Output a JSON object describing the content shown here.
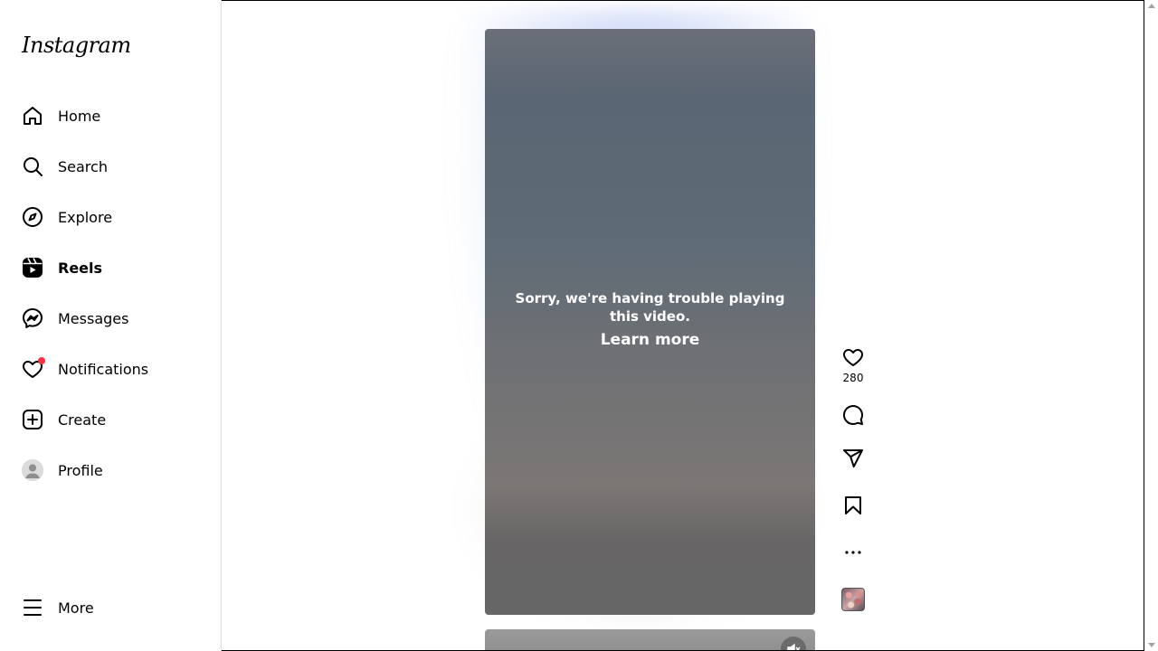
{
  "app": {
    "logo": "Instagram"
  },
  "sidebar": {
    "items": [
      {
        "label": "Home",
        "icon": "home-icon"
      },
      {
        "label": "Search",
        "icon": "search-icon"
      },
      {
        "label": "Explore",
        "icon": "compass-icon"
      },
      {
        "label": "Reels",
        "icon": "reels-icon",
        "active": true
      },
      {
        "label": "Messages",
        "icon": "messenger-icon"
      },
      {
        "label": "Notifications",
        "icon": "heart-icon",
        "badge": "dot"
      },
      {
        "label": "Create",
        "icon": "plus-square-icon"
      },
      {
        "label": "Profile",
        "icon": "avatar"
      }
    ],
    "more": {
      "label": "More",
      "icon": "hamburger-icon"
    }
  },
  "reel": {
    "error_text": "Sorry, we're having trouble playing this video.",
    "learn_more": "Learn more",
    "likes": "280"
  },
  "colors": {
    "notification_dot": "#ff3040",
    "border": "#dbdbdb"
  }
}
